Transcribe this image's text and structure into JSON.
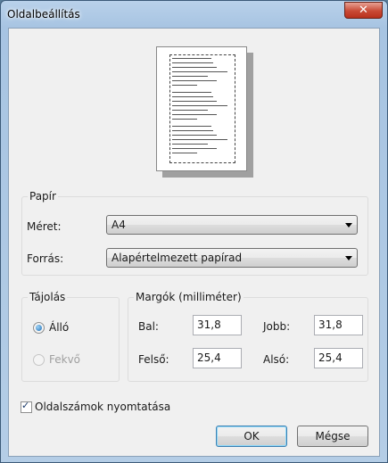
{
  "window": {
    "title": "Oldalbeállítás",
    "close_glyph": "✕"
  },
  "paper": {
    "group_label": "Papír",
    "size_label": "Méret:",
    "size_value": "A4",
    "source_label": "Forrás:",
    "source_value": "Alapértelmezett papírad"
  },
  "orientation": {
    "group_label": "Tájolás",
    "portrait_label": "Álló",
    "portrait_selected": true,
    "landscape_label": "Fekvő",
    "landscape_enabled": false
  },
  "margins": {
    "group_label": "Margók (milliméter)",
    "left_label": "Bal:",
    "left_value": "31,8",
    "right_label": "Jobb:",
    "right_value": "31,8",
    "top_label": "Felső:",
    "top_value": "25,4",
    "bottom_label": "Alsó:",
    "bottom_value": "25,4"
  },
  "print_page_numbers": {
    "label": "Oldalszámok nyomtatása",
    "checked": true
  },
  "buttons": {
    "ok": "OK",
    "cancel": "Mégse"
  },
  "icons": {
    "close": "close-icon",
    "dropdown": "chevron-down-icon",
    "checkmark": "checkmark-icon"
  }
}
